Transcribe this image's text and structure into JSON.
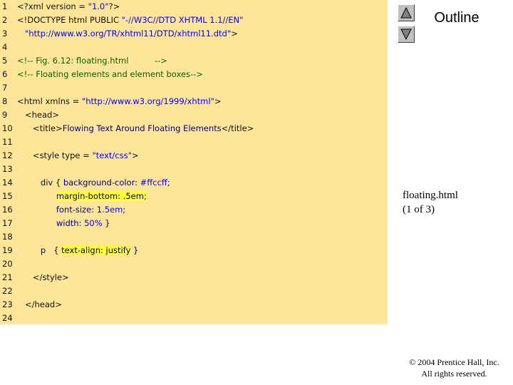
{
  "outline": {
    "title": "Outline",
    "prev_icon": "triangle-up-icon",
    "next_icon": "triangle-down-icon"
  },
  "caption": {
    "filename": "floating.html",
    "page": "(1 of 3)"
  },
  "copyright": {
    "line1": "© 2004 Prentice Hall, Inc.",
    "line2": "All rights reserved."
  },
  "colors": {
    "code_background": "#ffe599",
    "highlight": "#ffff3c",
    "keyword": "#000080",
    "string": "#0000ff",
    "comment": "#006400"
  },
  "code_lines": [
    {
      "n": "1",
      "parts": [
        {
          "t": "<?xml version = "
        },
        {
          "t": "\"1.0\"",
          "c": "s"
        },
        {
          "t": "?>"
        }
      ]
    },
    {
      "n": "2",
      "parts": [
        {
          "t": "<!DOCTYPE html PUBLIC "
        },
        {
          "t": "\"-//W3C//DTD XHTML 1.1//EN\"",
          "c": "s"
        }
      ]
    },
    {
      "n": "3",
      "parts": [
        {
          "t": "   "
        },
        {
          "t": "\"http://www.w3.org/TR/xhtml11/DTD/xhtml11.dtd\"",
          "c": "s"
        },
        {
          "t": ">"
        }
      ]
    },
    {
      "n": "4",
      "parts": []
    },
    {
      "n": "5",
      "parts": [
        {
          "t": "<!-- Fig. 6.12: floating.html          -->",
          "c": "c"
        }
      ]
    },
    {
      "n": "6",
      "parts": [
        {
          "t": "<!-- Floating elements and element boxes-->",
          "c": "c"
        }
      ]
    },
    {
      "n": "7",
      "parts": []
    },
    {
      "n": "8",
      "parts": [
        {
          "t": "<html xmlns = "
        },
        {
          "t": "\"http://www.w3.org/1999/xhtml\"",
          "c": "s"
        },
        {
          "t": ">"
        }
      ]
    },
    {
      "n": "9",
      "parts": [
        {
          "t": "   <head>"
        }
      ]
    },
    {
      "n": "10",
      "parts": [
        {
          "t": "      <title>"
        },
        {
          "t": "Flowing Text Around Floating Elements",
          "c": "k"
        },
        {
          "t": "</title>"
        }
      ]
    },
    {
      "n": "11",
      "parts": []
    },
    {
      "n": "12",
      "parts": [
        {
          "t": "      <style type = "
        },
        {
          "t": "\"text/css\"",
          "c": "s"
        },
        {
          "t": ">"
        }
      ]
    },
    {
      "n": "13",
      "parts": []
    },
    {
      "n": "14",
      "parts": [
        {
          "t": "         div { "
        },
        {
          "t": "background-color:",
          "c": "k"
        },
        {
          "t": " "
        },
        {
          "t": "#ffccff",
          "c": "s"
        },
        {
          "t": ";"
        }
      ]
    },
    {
      "n": "15",
      "parts": [
        {
          "t": "               "
        },
        {
          "t": "margin-bottom: .5em;",
          "c": "k",
          "h": true
        }
      ]
    },
    {
      "n": "16",
      "parts": [
        {
          "t": "               "
        },
        {
          "t": "font-size:",
          "c": "k"
        },
        {
          "t": " "
        },
        {
          "t": "1.5em",
          "c": "s"
        },
        {
          "t": ";"
        }
      ]
    },
    {
      "n": "17",
      "parts": [
        {
          "t": "               "
        },
        {
          "t": "width:",
          "c": "k"
        },
        {
          "t": " "
        },
        {
          "t": "50%",
          "c": "s"
        },
        {
          "t": " }"
        }
      ]
    },
    {
      "n": "18",
      "parts": []
    },
    {
      "n": "19",
      "parts": [
        {
          "t": "         p   { "
        },
        {
          "t": "text-align: justify",
          "c": "k",
          "h": true
        },
        {
          "t": " }"
        }
      ]
    },
    {
      "n": "20",
      "parts": []
    },
    {
      "n": "21",
      "parts": [
        {
          "t": "      </style>"
        }
      ]
    },
    {
      "n": "22",
      "parts": []
    },
    {
      "n": "23",
      "parts": [
        {
          "t": "   </head>"
        }
      ]
    },
    {
      "n": "24",
      "parts": []
    }
  ]
}
